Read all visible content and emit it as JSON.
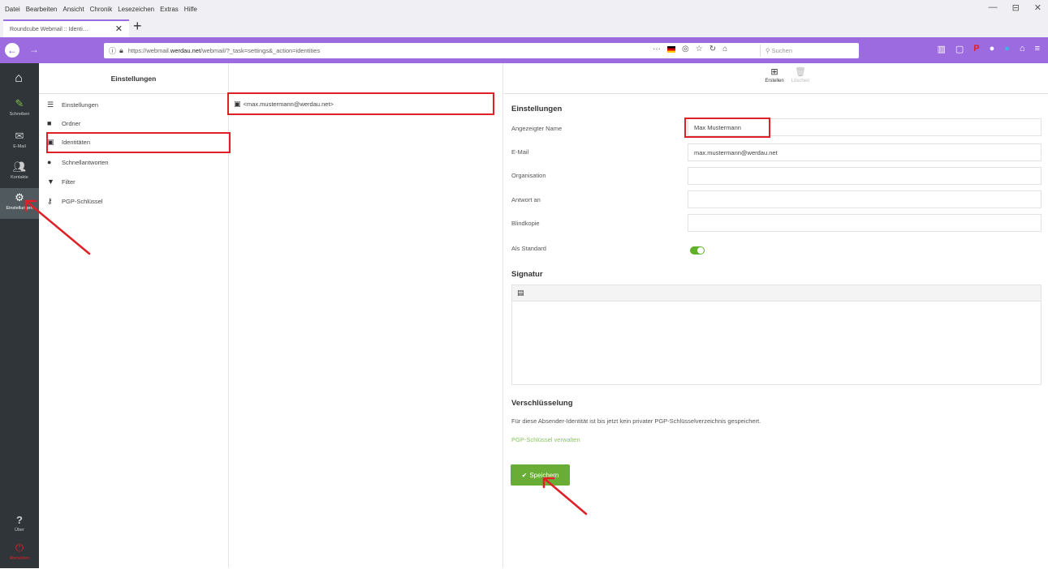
{
  "menubar": {
    "items": [
      "Datei",
      "Bearbeiten",
      "Ansicht",
      "Chronik",
      "Lesezeichen",
      "Extras",
      "Hilfe"
    ],
    "window_controls": [
      "—",
      "⊟",
      "✕"
    ]
  },
  "browser": {
    "tab_title": "Roundcube Webmail :: Identi…",
    "url_prefix": "https://webmail.",
    "url_domain": "werdau.net",
    "url_suffix": "/webmail/?_task=settings&_action=identities",
    "search_placeholder": "Suchen"
  },
  "appnav": {
    "items": [
      {
        "label": "Schreiben",
        "icon": "edit-icon"
      },
      {
        "label": "E-Mail",
        "icon": "mail-icon"
      },
      {
        "label": "Kontakte",
        "icon": "contacts-icon"
      },
      {
        "label": "Einstellungen",
        "icon": "gear-icon"
      }
    ],
    "bottom": [
      {
        "label": "Über",
        "icon": "help-icon"
      },
      {
        "label": "Abmelden",
        "icon": "power-icon"
      }
    ]
  },
  "settings": {
    "header": "Einstellungen",
    "items": [
      {
        "label": "Einstellungen",
        "icon": "sliders-icon"
      },
      {
        "label": "Ordner",
        "icon": "folder-icon"
      },
      {
        "label": "Identitäten",
        "icon": "id-card-icon"
      },
      {
        "label": "Schnellantworten",
        "icon": "comment-icon"
      },
      {
        "label": "Filter",
        "icon": "filter-icon"
      },
      {
        "label": "PGP-Schlüssel",
        "icon": "key-icon"
      }
    ]
  },
  "identities": {
    "items": [
      "<max.mustermann@werdau.net>"
    ]
  },
  "toolbar": {
    "create_label": "Erstellen",
    "delete_label": "Löschen"
  },
  "form": {
    "section_title": "Einstellungen",
    "name_label": "Angezeigter Name",
    "name_value": "Max Mustermann",
    "email_label": "E-Mail",
    "email_value": "max.mustermann@werdau.net",
    "org_label": "Organisation",
    "org_value": "",
    "reply_label": "Antwort an",
    "reply_value": "",
    "bcc_label": "Blindkopie",
    "bcc_value": "",
    "default_label": "Als Standard",
    "default_on": true,
    "signature_title": "Signatur",
    "encryption_title": "Verschlüsselung",
    "encryption_text": "Für diese Absender-Identität ist bis jetzt kein privater PGP-Schlüsselverzeichnis gespeichert.",
    "pgp_link": "PGP-Schlüssel verwalten",
    "save_label": "Speichern"
  },
  "colors": {
    "browser_accent": "#9d6be0",
    "sidebar_bg": "#2f3538",
    "primary_green": "#6aad36",
    "annotation_red": "#e02027"
  }
}
